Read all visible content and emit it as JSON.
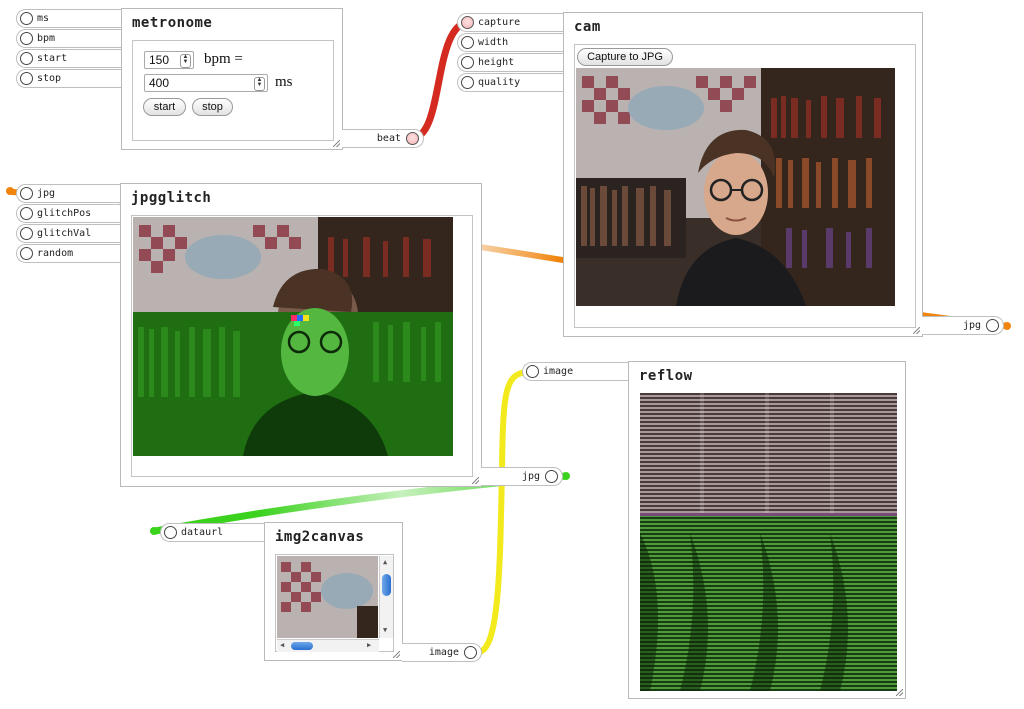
{
  "colors": {
    "wire_beat": "#d42a20",
    "wire_jpg": "#f0840c",
    "wire_image": "#f2ea1c",
    "wire_dataurl": "#3bd21e"
  },
  "metronome": {
    "title": "metronome",
    "inputs": [
      "ms",
      "bpm",
      "start",
      "stop"
    ],
    "bpm_value": "150",
    "bpm_label": "bpm =",
    "ms_value": "400",
    "ms_label": "ms",
    "start_button": "start",
    "stop_button": "stop",
    "output": "beat"
  },
  "cam": {
    "title": "cam",
    "inputs": [
      "capture",
      "width",
      "height",
      "quality"
    ],
    "capture_button": "Capture to JPG",
    "output": "jpg"
  },
  "jpgglitch": {
    "title": "jpgglitch",
    "inputs": [
      "jpg",
      "glitchPos",
      "glitchVal",
      "random"
    ],
    "output": "jpg"
  },
  "reflow": {
    "title": "reflow",
    "input": "image"
  },
  "img2canvas": {
    "title": "img2canvas",
    "input": "dataurl",
    "output": "image"
  }
}
